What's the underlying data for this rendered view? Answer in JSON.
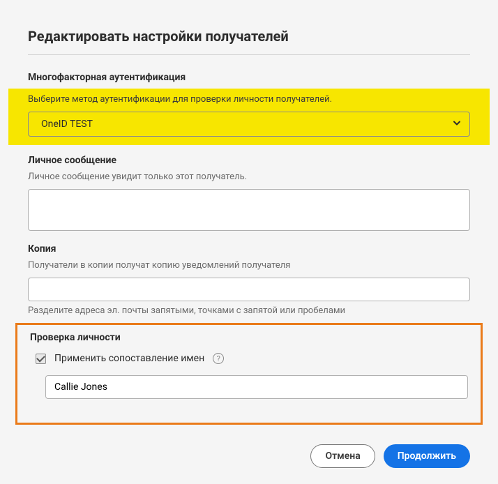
{
  "title": "Редактировать настройки получателей",
  "mfa": {
    "label": "Многофакторная аутентификация",
    "helper": "Выберите метод аутентификации для проверки личности получателей.",
    "selected": "OneID TEST"
  },
  "message": {
    "label": "Личное сообщение",
    "helper": "Личное сообщение увидит только этот получатель.",
    "value": ""
  },
  "cc": {
    "label": "Копия",
    "helper": "Получатели в копии получат копию уведомлений получателя",
    "value": "",
    "helper_below": "Разделите адреса эл. почты запятыми, точками с запятой или пробелами"
  },
  "identity": {
    "label": "Проверка личности",
    "checkbox_label": "Применить сопоставление имен",
    "checked": true,
    "name_value": "Callie Jones"
  },
  "footer": {
    "cancel": "Отмена",
    "continue": "Продолжить"
  }
}
